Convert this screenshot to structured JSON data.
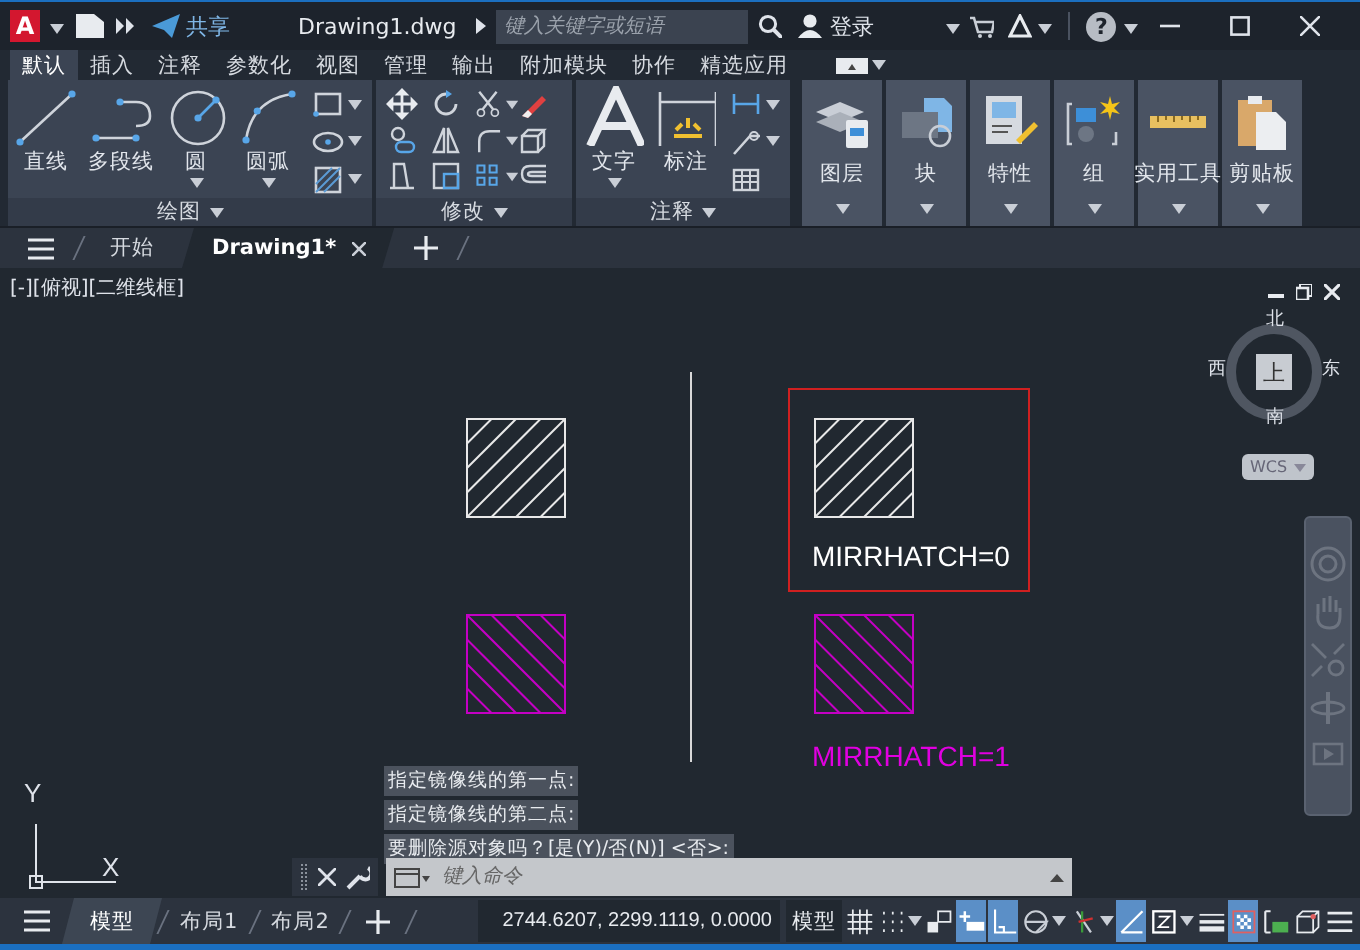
{
  "title_bar": {
    "logo_letter": "A",
    "share_label": "共享",
    "document_title": "Drawing1.dwg",
    "search": {
      "placeholder": "键入关键字或短语"
    },
    "sign_in": "登录",
    "help": "?"
  },
  "ribbon_tabs": [
    {
      "label": "默认",
      "selected": true
    },
    {
      "label": "插入",
      "selected": false
    },
    {
      "label": "注释",
      "selected": false
    },
    {
      "label": "参数化",
      "selected": false
    },
    {
      "label": "视图",
      "selected": false
    },
    {
      "label": "管理",
      "selected": false
    },
    {
      "label": "输出",
      "selected": false
    },
    {
      "label": "附加模块",
      "selected": false
    },
    {
      "label": "协作",
      "selected": false
    },
    {
      "label": "精选应用",
      "selected": false
    }
  ],
  "ribbon_panels": [
    {
      "title": "绘图",
      "large_tools": [
        {
          "label": "直线",
          "dropdown": false
        },
        {
          "label": "多段线",
          "dropdown": false
        },
        {
          "label": "圆",
          "dropdown": true
        },
        {
          "label": "圆弧",
          "dropdown": true
        }
      ]
    },
    {
      "title": "修改"
    },
    {
      "title": "注释",
      "large_tools": [
        {
          "label": "文字",
          "dropdown": true
        },
        {
          "label": "标注",
          "dropdown": false
        }
      ]
    }
  ],
  "ribbon_buttons": [
    "图层",
    "块",
    "特性",
    "组",
    "实用工具",
    "剪贴板"
  ],
  "file_tabs": [
    {
      "label": "开始",
      "selected": false
    },
    {
      "label": "Drawing1*",
      "selected": true
    }
  ],
  "viewport_label": "[-][俯视][二维线框]",
  "view_cube": {
    "north": "北",
    "south": "南",
    "east": "东",
    "west": "西",
    "face": "上",
    "ucs_menu": "WCS"
  },
  "drawing": {
    "annotations": [
      {
        "text": "MIRRHATCH=0",
        "color": "#ffffff"
      },
      {
        "text": "MIRRHATCH=1",
        "color": "#e000e0"
      }
    ]
  },
  "ucs_icon": {
    "x_label": "X",
    "y_label": "Y"
  },
  "command_history": [
    "指定镜像线的第一点:",
    "指定镜像线的第二点:",
    "要删除源对象吗？[是(Y)/否(N)] <否>:"
  ],
  "command_line": {
    "placeholder": "键入命令"
  },
  "layout_tabs": [
    {
      "label": "模型",
      "selected": true
    },
    {
      "label": "布局1",
      "selected": false
    },
    {
      "label": "布局2",
      "selected": false
    }
  ],
  "status_bar": {
    "coordinates": "2744.6207, 2299.1119, 0.0000",
    "space_button": "模型",
    "toggles": [
      {
        "kind": "grid",
        "on": false,
        "dropdown": false
      },
      {
        "kind": "snap",
        "on": false,
        "dropdown": true
      },
      {
        "kind": "infer",
        "on": false,
        "dropdown": false
      },
      {
        "kind": "dynamic-input",
        "on": true,
        "dropdown": false
      },
      {
        "kind": "ortho",
        "on": true,
        "dropdown": false
      },
      {
        "kind": "polar",
        "on": false,
        "dropdown": true
      },
      {
        "kind": "isodraft",
        "on": false,
        "dropdown": true
      },
      {
        "kind": "tracking",
        "on": true,
        "dropdown": false
      },
      {
        "kind": "osnap",
        "on": false,
        "dropdown": true
      },
      {
        "kind": "lineweight",
        "on": false,
        "dropdown": false
      },
      {
        "kind": "transparency",
        "on": true,
        "dropdown": false
      },
      {
        "kind": "selection-cycling",
        "on": false,
        "dropdown": false
      },
      {
        "kind": "osnap-3d",
        "on": false,
        "dropdown": false
      },
      {
        "kind": "menu",
        "on": false,
        "dropdown": false
      }
    ]
  }
}
